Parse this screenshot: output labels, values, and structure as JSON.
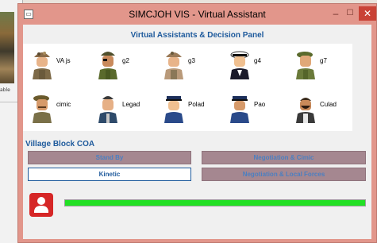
{
  "background_app": {
    "caption": "able"
  },
  "window": {
    "title": "SIMCJOH VIS - Virtual Assistant",
    "controls": {
      "minimize": "–",
      "maximize": "☐",
      "close": "✕"
    }
  },
  "panel": {
    "title": "Virtual Assistants & Decision Panel",
    "agents": [
      {
        "name": "VA js",
        "icon": "soldier-camo-cap-icon"
      },
      {
        "name": "g2",
        "icon": "soldier-eyepatch-icon"
      },
      {
        "name": "g3",
        "icon": "soldier-camo-cap-icon"
      },
      {
        "name": "g4",
        "icon": "naval-officer-icon"
      },
      {
        "name": "g7",
        "icon": "soldier-beret-icon"
      },
      {
        "name": "cimic",
        "icon": "soldier-beret-icon"
      },
      {
        "name": "Legad",
        "icon": "officer-uniform-icon"
      },
      {
        "name": "Polad",
        "icon": "police-officer-icon"
      },
      {
        "name": "Pao",
        "icon": "police-officer-icon"
      },
      {
        "name": "Culad",
        "icon": "civilian-beard-icon"
      }
    ]
  },
  "coa": {
    "title": "Village Block COA",
    "buttons": {
      "stand_by": "Stand By",
      "negotiation_cimic": "Negotiation & Cimic",
      "kinetic": "Kinetic",
      "negotiation_local": "Negotiation & Local Forces"
    },
    "selected": "Kinetic"
  },
  "status": {
    "icon": "user-icon",
    "progress_fraction": 1.0
  },
  "colors": {
    "title_bar": "#e2968b",
    "heading_blue": "#1e5a9c",
    "button_inactive": "#a58790",
    "progress_green": "#22e024",
    "user_icon_red": "#d62727"
  }
}
